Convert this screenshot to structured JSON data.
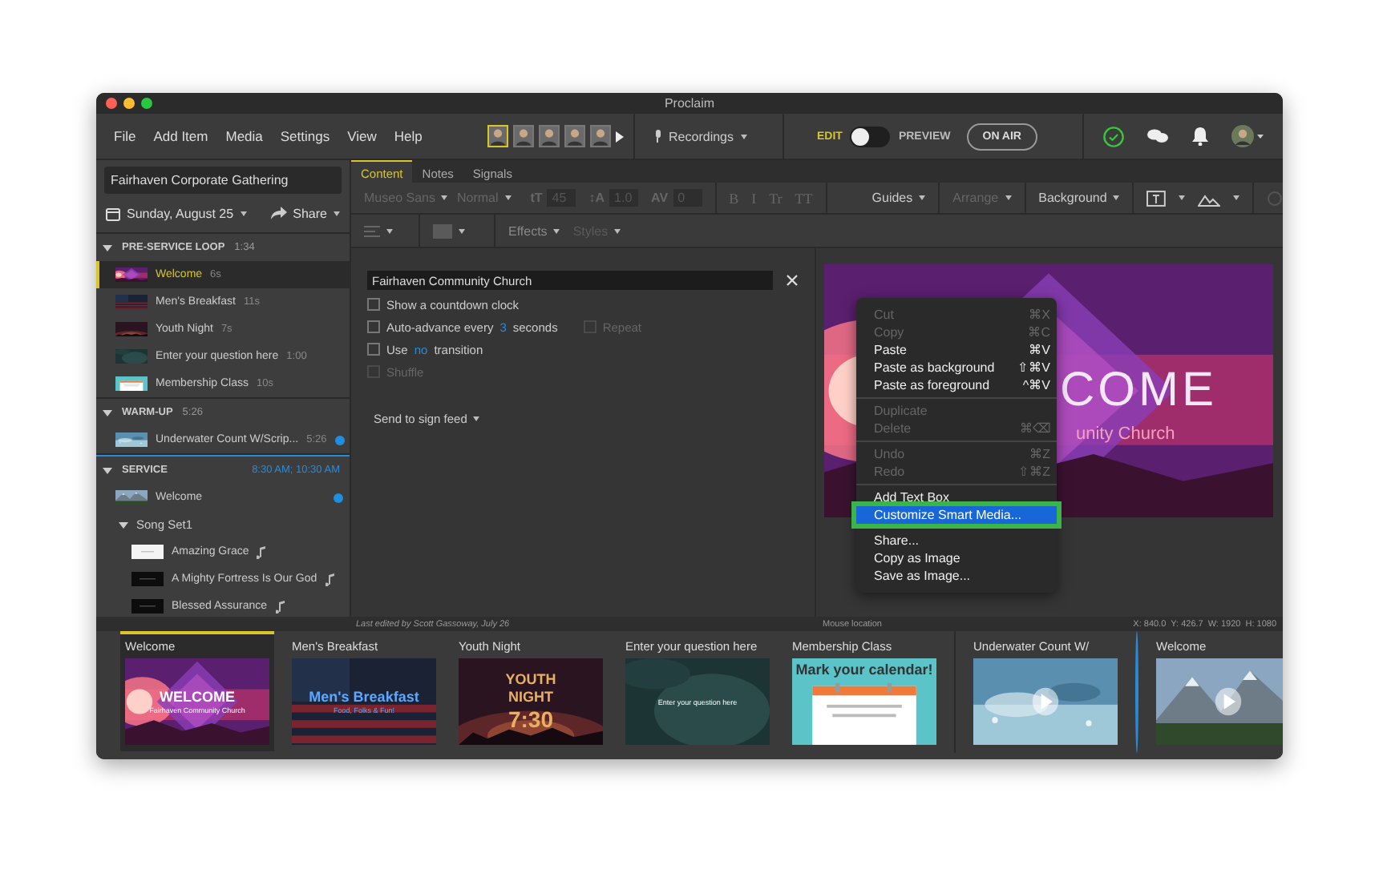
{
  "window": {
    "title": "Proclaim"
  },
  "menu": [
    "File",
    "Add Item",
    "Media",
    "Settings",
    "View",
    "Help"
  ],
  "header": {
    "avatars": [
      {
        "selected": true
      },
      {
        "selected": false
      },
      {
        "selected": false
      },
      {
        "selected": false
      },
      {
        "selected": false
      }
    ],
    "recordings": "Recordings",
    "edit_label": "EDIT",
    "preview_label": "PREVIEW",
    "preview_on": false,
    "on_air": "ON AIR"
  },
  "sidebar": {
    "title_field": "Fairhaven Corporate Gathering",
    "date": "Sunday, August 25",
    "share": "Share",
    "sections": [
      {
        "title": "PRE-SERVICE LOOP",
        "time": "1:34",
        "accent": false,
        "expanded": true,
        "items": [
          {
            "kind": "slide",
            "label": "Welcome",
            "duration": "6s",
            "selected": true,
            "live": false
          },
          {
            "kind": "slide",
            "label": "Men's Breakfast",
            "duration": "11s",
            "selected": false,
            "live": false
          },
          {
            "kind": "slide",
            "label": "Youth Night",
            "duration": "7s",
            "selected": false,
            "live": false
          },
          {
            "kind": "slide",
            "label": "Enter your question here",
            "duration": "1:00",
            "selected": false,
            "live": false
          },
          {
            "kind": "slide",
            "label": "Membership Class",
            "duration": "10s",
            "selected": false,
            "live": false
          }
        ]
      },
      {
        "title": "WARM-UP",
        "time": "5:26",
        "accent": false,
        "expanded": true,
        "items": [
          {
            "kind": "slide",
            "label": "Underwater Count W/Scrip...",
            "duration": "5:26",
            "selected": false,
            "live": true
          }
        ]
      },
      {
        "title": "SERVICE",
        "time": "8:30 AM; 10:30 AM",
        "accent": true,
        "expanded": true,
        "items": [
          {
            "kind": "slide",
            "label": "Welcome",
            "selected": false,
            "live": true
          },
          {
            "kind": "group",
            "label": "Song Set1",
            "expanded": true,
            "children": [
              {
                "kind": "song",
                "label": "Amazing Grace",
                "selected": false,
                "live": false
              },
              {
                "kind": "song",
                "label": "A Mighty Fortress Is Our God",
                "selected": false,
                "live": false
              },
              {
                "kind": "song",
                "label": "Blessed Assurance",
                "selected": false,
                "live": false
              }
            ]
          }
        ]
      }
    ]
  },
  "tabs": [
    {
      "label": "Content",
      "selected": true
    },
    {
      "label": "Notes",
      "selected": false
    },
    {
      "label": "Signals",
      "selected": false
    }
  ],
  "format_bar": {
    "font": "Museo Sans",
    "weight": "Normal",
    "fields": [
      {
        "glyph": "tT",
        "value": "45"
      },
      {
        "glyph": "↕A",
        "value": "1.0"
      },
      {
        "glyph": "AV",
        "value": "0"
      }
    ],
    "styles": [
      "B",
      "I",
      "Tr",
      "TT"
    ],
    "menus": [
      {
        "label": "Guides",
        "disabled": false
      },
      {
        "label": "Arrange",
        "disabled": true
      },
      {
        "label": "Background",
        "disabled": false
      }
    ],
    "menus2": [
      {
        "label": "Effects",
        "disabled": false
      },
      {
        "label": "Styles",
        "disabled": true
      }
    ]
  },
  "editor": {
    "text_field": "Fairhaven Community Church",
    "options": [
      {
        "before": "Show a countdown clock",
        "checked": false,
        "disabled": false
      },
      {
        "before": "Auto-advance every",
        "link": "3",
        "after": "seconds",
        "checked": false,
        "disabled": false,
        "extra": {
          "label": "Repeat",
          "checked": false,
          "disabled": true
        }
      },
      {
        "before": "Use",
        "link": "no",
        "after": "transition",
        "checked": false,
        "disabled": false
      },
      {
        "before": "Shuffle",
        "checked": false,
        "disabled": true
      }
    ],
    "sign_feed": "Send to sign feed"
  },
  "preview": {
    "title": "COME",
    "subtitle": "unity Church"
  },
  "context_menu": {
    "groups": [
      [
        {
          "label": "Cut",
          "shortcut": "⌘X",
          "disabled": true,
          "selected": false
        },
        {
          "label": "Copy",
          "shortcut": "⌘C",
          "disabled": true,
          "selected": false
        },
        {
          "label": "Paste",
          "shortcut": "⌘V",
          "disabled": false,
          "selected": false
        },
        {
          "label": "Paste as background",
          "shortcut": "⇧⌘V",
          "disabled": false,
          "selected": false
        },
        {
          "label": "Paste as foreground",
          "shortcut": "^⌘V",
          "disabled": false,
          "selected": false
        }
      ],
      [
        {
          "label": "Duplicate",
          "disabled": true,
          "selected": false
        },
        {
          "label": "Delete",
          "shortcut": "⌘⌫",
          "disabled": true,
          "selected": false
        }
      ],
      [
        {
          "label": "Undo",
          "shortcut": "⌘Z",
          "disabled": true,
          "selected": false
        },
        {
          "label": "Redo",
          "shortcut": "⇧⌘Z",
          "disabled": true,
          "selected": false
        }
      ],
      [
        {
          "label": "Add Text Box",
          "disabled": false,
          "selected": false
        },
        {
          "label": "Customize Smart Media...",
          "disabled": false,
          "selected": true
        }
      ],
      [
        {
          "label": "Share...",
          "disabled": false,
          "selected": false
        },
        {
          "label": "Copy as Image",
          "disabled": false,
          "selected": false
        },
        {
          "label": "Save as Image...",
          "disabled": false,
          "selected": false
        }
      ]
    ]
  },
  "status_bar": {
    "last_edited": "Last edited by Scott Gassoway, July 26",
    "mouse": "Mouse location",
    "coords": [
      "X: 840.0",
      "Y: 426.7",
      "W: 1920",
      "H: 1080"
    ]
  },
  "strip": [
    {
      "title": "Welcome",
      "selected": true,
      "group_start": false,
      "live": false,
      "slide_texts": [
        {
          "kind": "title",
          "text": "WELCOME"
        },
        {
          "kind": "sub",
          "text": "Fairhaven Community Church"
        }
      ]
    },
    {
      "title": "Men's Breakfast",
      "selected": false,
      "group_start": false,
      "live": false,
      "slide_texts": [
        {
          "kind": "title",
          "text": "Men's Breakfast"
        },
        {
          "kind": "sub",
          "text": "Food, Folks & Fun!"
        }
      ]
    },
    {
      "title": "Youth Night",
      "selected": false,
      "group_start": false,
      "live": false,
      "slide_texts": [
        {
          "kind": "title",
          "text": "YOUTH"
        },
        {
          "kind": "title",
          "text": "NIGHT"
        },
        {
          "kind": "big",
          "text": "7:30"
        }
      ]
    },
    {
      "title": "Enter your question here",
      "selected": false,
      "group_start": false,
      "live": false,
      "slide_texts": [
        {
          "kind": "sub",
          "text": "Enter your question here"
        }
      ]
    },
    {
      "title": "Membership Class",
      "selected": false,
      "group_start": false,
      "live": false,
      "slide_texts": [
        {
          "kind": "title",
          "text": "Mark your calendar!"
        }
      ]
    },
    {
      "title": "Underwater Count W/",
      "selected": false,
      "group_start": true,
      "live": false
    },
    {
      "title": "Welcome",
      "selected": false,
      "group_start": true,
      "live": true
    }
  ]
}
